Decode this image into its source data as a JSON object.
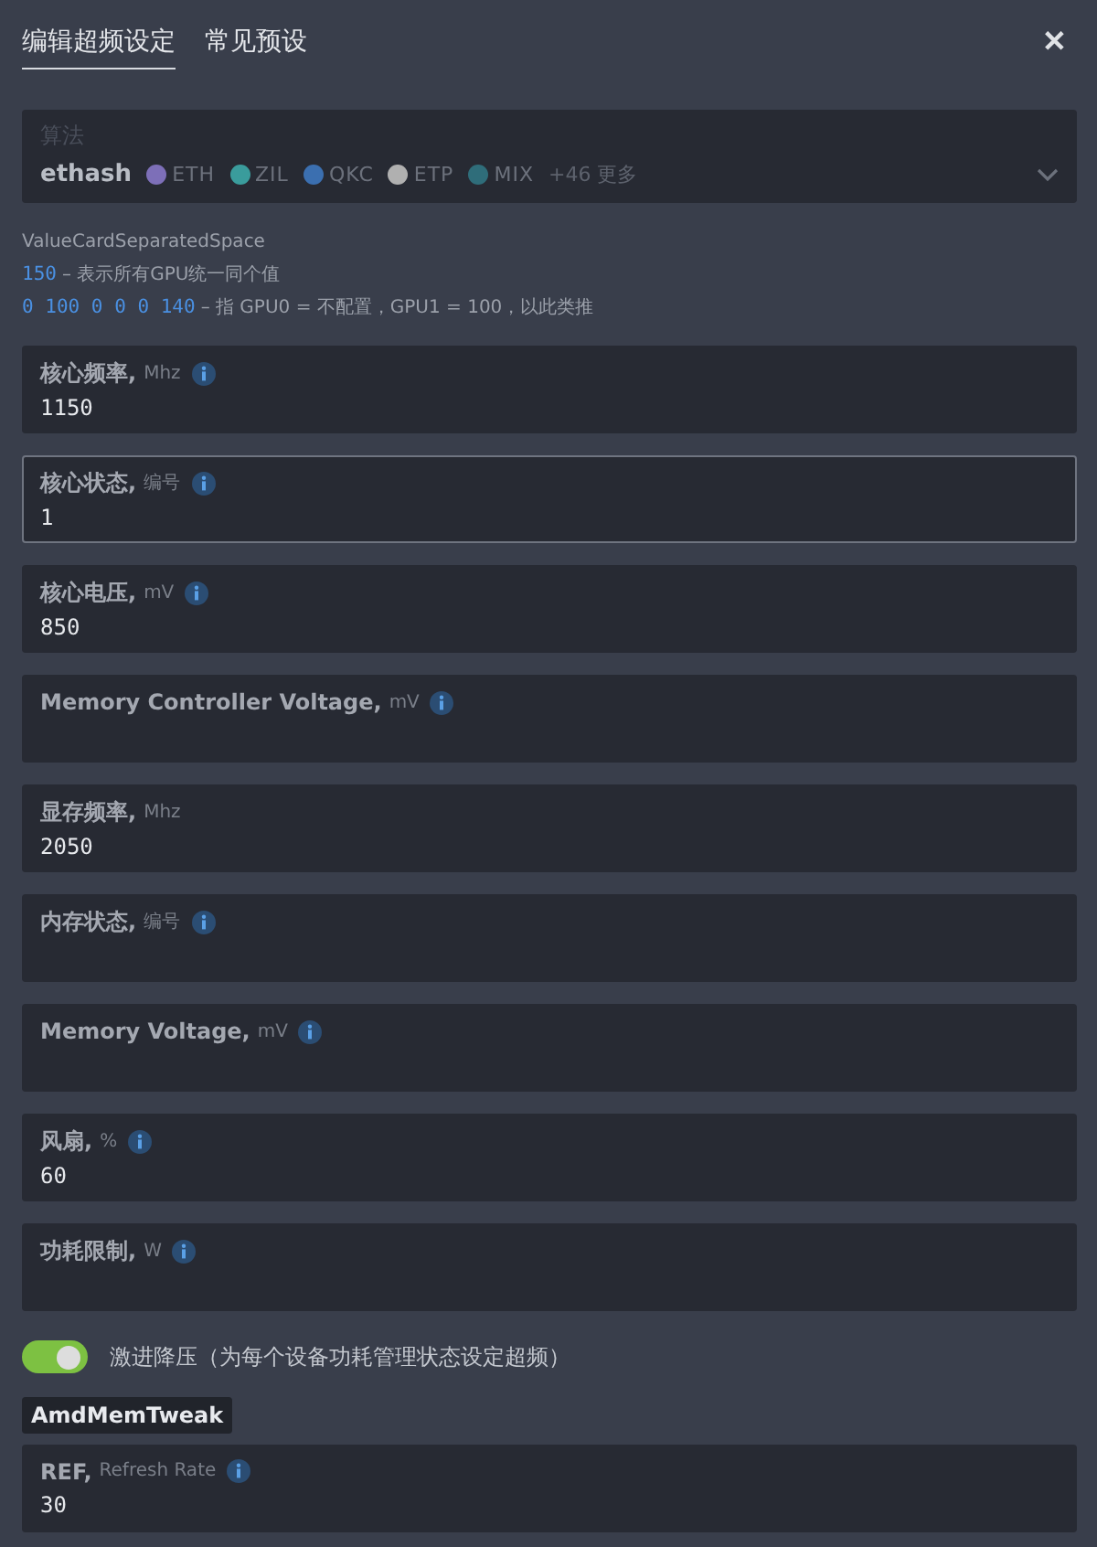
{
  "tabs": [
    {
      "label": "编辑超频设定",
      "selected": true
    },
    {
      "label": "常见预设",
      "selected": false
    }
  ],
  "close": "✕",
  "algorithm": {
    "label": "算法",
    "value": "ethash",
    "coins": [
      {
        "symbol": "ETH",
        "color": "#7d6fb8"
      },
      {
        "symbol": "ZIL",
        "color": "#3a9c9c"
      },
      {
        "symbol": "QKC",
        "color": "#3b6fb0"
      },
      {
        "symbol": "ETP",
        "color": "#b0b0b0"
      },
      {
        "symbol": "MIX",
        "color": "#2f6d7a"
      }
    ],
    "more": "+46 更多"
  },
  "help": [
    {
      "title": "ValueCardSeparatedSpace"
    },
    {
      "code": "150",
      "text": "– 表示所有GPU统一同个值"
    },
    {
      "code": "0 100 0 0 0 140",
      "text": "– 指 GPU0 = 不配置，GPU1 = 100，以此类推"
    }
  ],
  "fields": [
    {
      "label": "核心频率,",
      "unit": "Mhz",
      "info": true,
      "value": "1150",
      "focused": false
    },
    {
      "label": "核心状态,",
      "unit": "编号",
      "info": true,
      "value": "1",
      "focused": true
    },
    {
      "label": "核心电压,",
      "unit": "mV",
      "info": true,
      "value": "850",
      "focused": false
    },
    {
      "label": "Memory Controller Voltage,",
      "unit": "mV",
      "info": true,
      "focused": false
    },
    {
      "label": "显存频率,",
      "unit": "Mhz",
      "info": false,
      "value": "2050",
      "focused": false
    },
    {
      "label": "内存状态,",
      "unit": "编号",
      "info": true,
      "focused": false
    },
    {
      "label": "Memory Voltage,",
      "unit": "mV",
      "info": true,
      "focused": false
    },
    {
      "label": "风扇,",
      "unit": "%",
      "info": true,
      "value": "60",
      "focused": false
    },
    {
      "label": "功耗限制,",
      "unit": "W",
      "info": true,
      "focused": false
    }
  ],
  "toggle": {
    "label": "激进降压（为每个设备功耗管理状态设定超频）",
    "on": true
  },
  "section": "AmdMemTweak",
  "tweak_fields": [
    {
      "label": "REF,",
      "unit": "Refresh Rate",
      "info": true,
      "value": "30",
      "focused": false
    }
  ]
}
